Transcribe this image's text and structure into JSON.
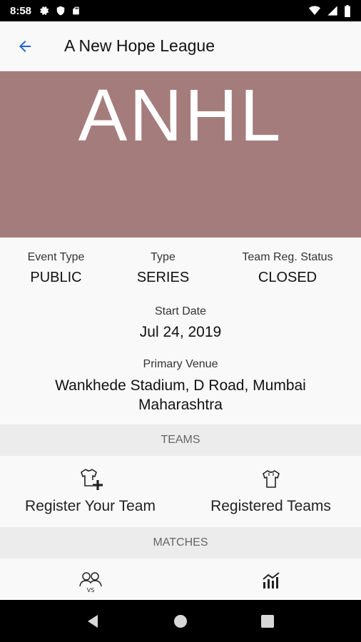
{
  "status_bar": {
    "time": "8:58",
    "icons": [
      "settings-gear",
      "shield",
      "sd-card",
      "wifi",
      "signal",
      "battery"
    ]
  },
  "app_bar": {
    "title": "A New Hope League",
    "back_icon": "arrow-back"
  },
  "banner": {
    "text": "ANHL",
    "color": "#a57c7c"
  },
  "details": {
    "event_type": {
      "label": "Event Type",
      "value": "PUBLIC"
    },
    "type": {
      "label": "Type",
      "value": "SERIES"
    },
    "team_reg_status": {
      "label": "Team Reg. Status",
      "value": "CLOSED"
    },
    "start_date": {
      "label": "Start Date",
      "value": "Jul 24, 2019"
    },
    "primary_venue": {
      "label": "Primary Venue",
      "line1": "Wankhede Stadium, D Road, Mumbai",
      "line2": "Maharashtra"
    }
  },
  "teams_section": {
    "header": "TEAMS",
    "register_label": "Register Your Team",
    "registered_label": "Registered Teams"
  },
  "matches_section": {
    "header": "MATCHES",
    "icons": [
      "versus",
      "stats-chart"
    ]
  },
  "nav": {
    "icons": [
      "back-triangle",
      "home-circle",
      "recents-square"
    ]
  }
}
